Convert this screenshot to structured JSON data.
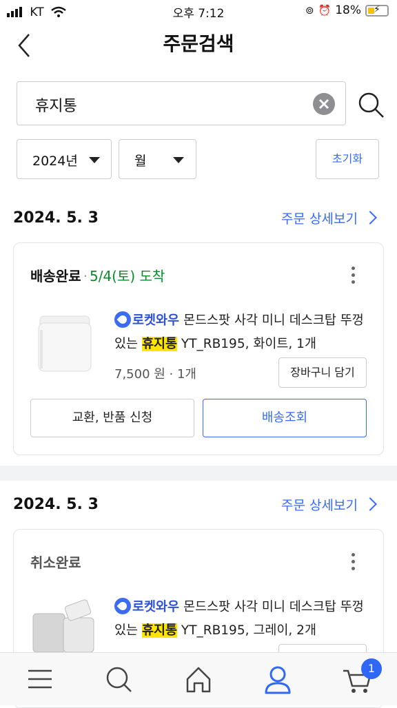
{
  "status_bar": {
    "carrier": "KT",
    "time": "오후 7:12",
    "battery": "18%"
  },
  "header": {
    "title": "주문검색"
  },
  "search": {
    "value": "휴지통"
  },
  "filters": {
    "year": "2024년",
    "month": "월",
    "reset_label": "초기화"
  },
  "orders": [
    {
      "date": "2024. 5. 3",
      "detail_link": "주문 상세보기",
      "status": "배송완료",
      "arrival": "5/4(토) 도착",
      "product": {
        "badge": "로켓와우",
        "name_before": "몬드스팟 사각 미니 데스크탑 뚜껑있는",
        "highlight": "휴지통",
        "name_after": "YT_RB195, 화이트, 1개",
        "price": "7,500 원 · 1개"
      },
      "cart_label": "장바구니 담기",
      "return_label": "교환, 반품 신청",
      "tracking_label": "배송조회"
    },
    {
      "date": "2024. 5. 3",
      "detail_link": "주문 상세보기",
      "status": "취소완료",
      "product": {
        "badge": "로켓와우",
        "name_before": "몬드스팟 사각 미니 데스크탑 뚜껑있는",
        "highlight": "휴지통",
        "name_after": "YT_RB195, 그레이, 2개"
      }
    }
  ],
  "bottom_nav": {
    "cart_count": "1"
  },
  "colors": {
    "accent": "#346aff",
    "arrival_green": "#0b8a2a",
    "highlight": "#ffe600"
  },
  "icons": [
    "back-chevron-icon",
    "clear-icon",
    "search-icon",
    "dropdown-triangle-icon",
    "chevron-right-icon",
    "more-vert-icon",
    "rocket-icon",
    "menu-icon",
    "home-icon",
    "user-icon",
    "cart-icon"
  ]
}
